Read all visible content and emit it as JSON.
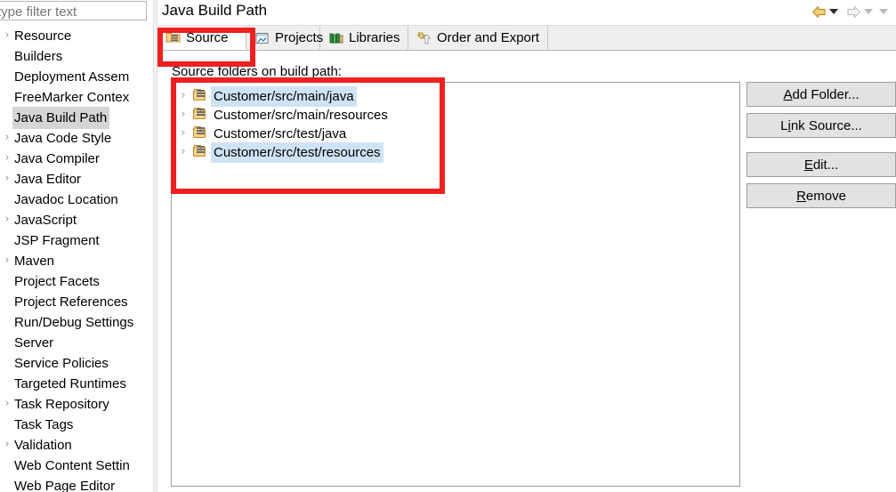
{
  "sidebar": {
    "filter": {
      "value": "",
      "placeholder": "type filter text"
    },
    "items": [
      {
        "label": "Resource",
        "expandable": true,
        "selected": false
      },
      {
        "label": "Builders",
        "expandable": false,
        "selected": false
      },
      {
        "label": "Deployment Assem",
        "expandable": false,
        "selected": false
      },
      {
        "label": "FreeMarker Contex",
        "expandable": false,
        "selected": false
      },
      {
        "label": "Java Build Path",
        "expandable": false,
        "selected": true
      },
      {
        "label": "Java Code Style",
        "expandable": true,
        "selected": false
      },
      {
        "label": "Java Compiler",
        "expandable": true,
        "selected": false
      },
      {
        "label": "Java Editor",
        "expandable": true,
        "selected": false
      },
      {
        "label": "Javadoc Location",
        "expandable": false,
        "selected": false
      },
      {
        "label": "JavaScript",
        "expandable": true,
        "selected": false
      },
      {
        "label": "JSP Fragment",
        "expandable": false,
        "selected": false
      },
      {
        "label": "Maven",
        "expandable": true,
        "selected": false
      },
      {
        "label": "Project Facets",
        "expandable": false,
        "selected": false
      },
      {
        "label": "Project References",
        "expandable": false,
        "selected": false
      },
      {
        "label": "Run/Debug Settings",
        "expandable": false,
        "selected": false
      },
      {
        "label": "Server",
        "expandable": false,
        "selected": false
      },
      {
        "label": "Service Policies",
        "expandable": false,
        "selected": false
      },
      {
        "label": "Targeted Runtimes",
        "expandable": false,
        "selected": false
      },
      {
        "label": "Task Repository",
        "expandable": true,
        "selected": false
      },
      {
        "label": "Task Tags",
        "expandable": false,
        "selected": false
      },
      {
        "label": "Validation",
        "expandable": true,
        "selected": false
      },
      {
        "label": "Web Content Settin",
        "expandable": false,
        "selected": false
      },
      {
        "label": "Web Page Editor",
        "expandable": false,
        "selected": false
      }
    ]
  },
  "header": {
    "title": "Java Build Path",
    "back_icon": "back-arrow-icon",
    "forward_icon": "forward-arrow-icon"
  },
  "tabs": [
    {
      "label": "Source",
      "icon": "source-folder-icon",
      "active": true
    },
    {
      "label": "Projects",
      "icon": "projects-icon",
      "active": false
    },
    {
      "label": "Libraries",
      "icon": "libraries-icon",
      "active": false
    },
    {
      "label": "Order and Export",
      "icon": "order-export-icon",
      "active": false
    }
  ],
  "main": {
    "section_label": "Source folders on build path:",
    "source_folders": [
      {
        "path": "Customer/src/main/java",
        "selected": true
      },
      {
        "path": "Customer/src/main/resources",
        "selected": false
      },
      {
        "path": "Customer/src/test/java",
        "selected": false
      },
      {
        "path": "Customer/src/test/resources",
        "selected": true
      }
    ]
  },
  "buttons": [
    {
      "label": "Add Folder...",
      "mnemonic_index": 0,
      "group": 1
    },
    {
      "label": "Link Source...",
      "mnemonic_index": 1,
      "group": 1
    },
    {
      "label": "Edit...",
      "mnemonic_index": 0,
      "group": 2
    },
    {
      "label": "Remove",
      "mnemonic_index": 0,
      "group": 2
    }
  ],
  "colors": {
    "selection_blue": "#cfe3f6",
    "sidebar_selection": "#d5d5d5",
    "annotation_red": "#ef2020",
    "button_face": "#e2e2e2",
    "tabbar": "#efefef"
  }
}
